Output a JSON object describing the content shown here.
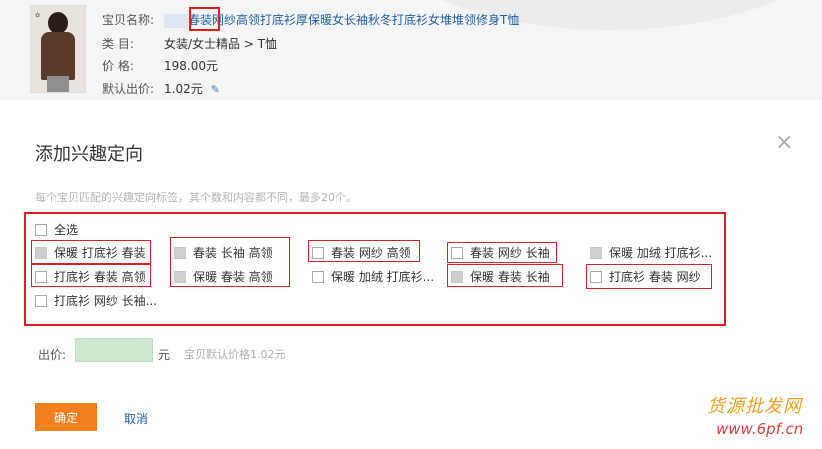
{
  "product": {
    "title_label": "宝贝名称:",
    "title_highlight": "春装",
    "title_rest": "网纱高领打底衫厚保暖女长袖秋冬打底衫女堆堆领修身T恤",
    "category_label": "类      目:",
    "category_value": "女装/女士精品 > T恤",
    "price_label": "价      格:",
    "price_value": "198.00元",
    "default_bid_label": "默认出价:",
    "default_bid_value": "1.02元"
  },
  "dialog": {
    "title": "添加兴趣定向",
    "close": "×",
    "hint": "每个宝贝匹配的兴趣定向标签，其个数和内容都不同，最多20个。",
    "select_all": "全选",
    "tags": [
      {
        "label": "保暖  打底衫  春装",
        "checked_style": "grey"
      },
      {
        "label": "春装  长袖  高领",
        "checked_style": "grey"
      },
      {
        "label": "春装  网纱  高领",
        "checked_style": "empty"
      },
      {
        "label": "春装  网纱  长袖",
        "checked_style": "empty"
      },
      {
        "label": "保暖  加绒  打底衫...",
        "checked_style": "grey"
      },
      {
        "label": "打底衫  春装  高领",
        "checked_style": "empty"
      },
      {
        "label": "保暖  春装  高领",
        "checked_style": "grey"
      },
      {
        "label": "保暖  加绒  打底衫...",
        "checked_style": "empty"
      },
      {
        "label": "保暖  春装  长袖",
        "checked_style": "grey"
      },
      {
        "label": "打底衫  春装  网纱",
        "checked_style": "empty"
      },
      {
        "label": "打底衫  网纱  长袖...",
        "checked_style": "empty"
      }
    ],
    "bid_label": "出价:",
    "bid_value": "",
    "bid_unit": "元",
    "bid_hint": "宝贝默认价格1.02元",
    "confirm": "确定",
    "cancel": "取消"
  },
  "watermark": {
    "line1": "货源批发网",
    "line2": "www.6pf.cn"
  },
  "colors": {
    "highlight_border": "#e02020",
    "confirm_bg": "#f28020",
    "link": "#1f5fa6",
    "bid_input_bg": "#cde8cf"
  }
}
